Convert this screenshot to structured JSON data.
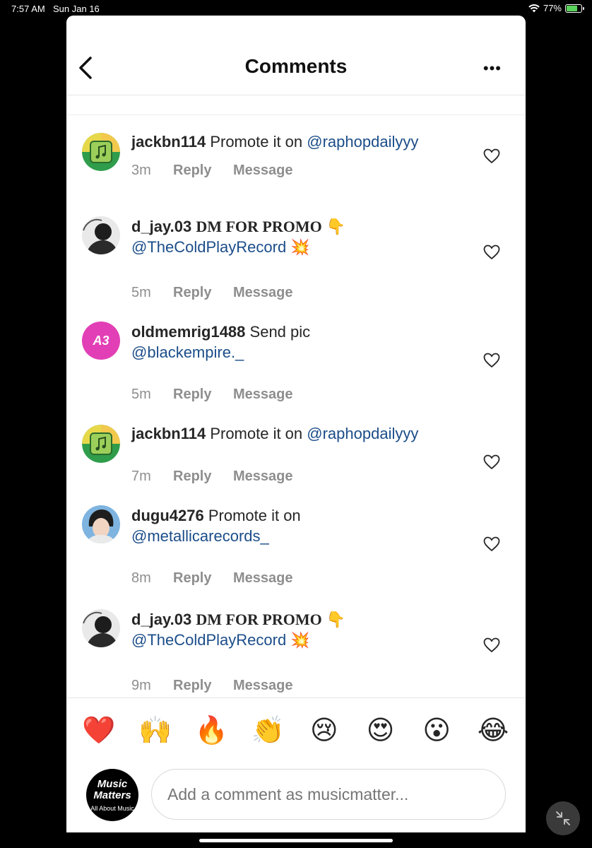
{
  "status_bar": {
    "time": "7:57 AM",
    "date": "Sun Jan 16",
    "battery": "77%",
    "battery_level": 0.77
  },
  "header": {
    "title": "Comments",
    "more": "•••"
  },
  "comments": [
    {
      "username": "jackbn114",
      "text": "Promote it on ",
      "mention": "@raphopdailyyy",
      "time": "3m",
      "reply": "Reply",
      "message": "Message",
      "avatar_icon": "music-note-icon"
    },
    {
      "username": "d_jay.03",
      "text": "DM FOR PROMO",
      "emoji1": "👇",
      "mention": "@TheColdPlayRecord",
      "emoji2": "💥",
      "time": "5m",
      "reply": "Reply",
      "message": "Message"
    },
    {
      "username": "oldmemrig1488",
      "text": "Send pic",
      "mention": "@blackempire._",
      "time": "5m",
      "reply": "Reply",
      "message": "Message",
      "avatar_text": "A3"
    },
    {
      "username": "jackbn114",
      "text": "Promote it on ",
      "mention": "@raphopdailyyy",
      "time": "7m",
      "reply": "Reply",
      "message": "Message",
      "avatar_icon": "music-note-icon"
    },
    {
      "username": "dugu4276",
      "text": "Promote it on",
      "mention": "@metallicarecords_",
      "time": "8m",
      "reply": "Reply",
      "message": "Message"
    },
    {
      "username": "d_jay.03",
      "text": "DM FOR PROMO",
      "emoji1": "👇",
      "mention": "@TheColdPlayRecord",
      "emoji2": "💥",
      "time": "9m",
      "reply": "Reply",
      "message": "Message"
    }
  ],
  "emojis": [
    "❤️",
    "🙌",
    "🔥",
    "👏",
    "😢",
    "😍",
    "😮",
    "😂"
  ],
  "composer": {
    "placeholder": "Add a comment as musicmatter...",
    "avatar_line1": "Music",
    "avatar_line2": "Matters",
    "avatar_line3": "All About Music"
  },
  "colors": {
    "mention": "#1b4d89",
    "meta": "#8e8e8e",
    "a3_avatar": "#e23fb6"
  }
}
